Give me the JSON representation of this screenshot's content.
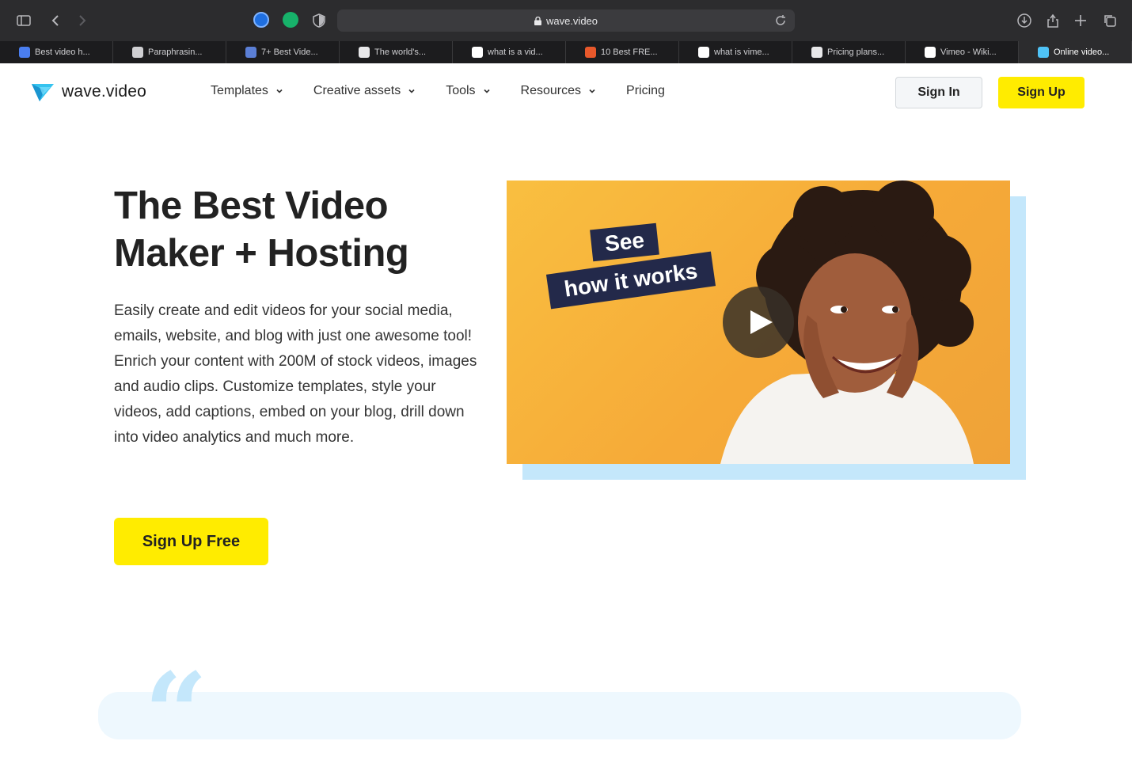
{
  "browser": {
    "url": "wave.video",
    "tabs": [
      {
        "label": "Best video h...",
        "color": "#4a7ef0"
      },
      {
        "label": "Paraphrasin...",
        "color": "#cfcfd2"
      },
      {
        "label": "7+ Best Vide...",
        "color": "#5b7fd6"
      },
      {
        "label": "The world's...",
        "color": "#e8e8ea"
      },
      {
        "label": "what is a vid...",
        "color": "#ffffff"
      },
      {
        "label": "10 Best FRE...",
        "color": "#e8582b"
      },
      {
        "label": "what is vime...",
        "color": "#ffffff"
      },
      {
        "label": "Pricing plans...",
        "color": "#e8e8ea"
      },
      {
        "label": "Vimeo - Wiki...",
        "color": "#ffffff"
      },
      {
        "label": "Online video...",
        "color": "#4fc3f7"
      }
    ]
  },
  "site": {
    "logo_text": "wave.video",
    "nav": [
      {
        "label": "Templates",
        "dropdown": true
      },
      {
        "label": "Creative assets",
        "dropdown": true
      },
      {
        "label": "Tools",
        "dropdown": true
      },
      {
        "label": "Resources",
        "dropdown": true
      },
      {
        "label": "Pricing",
        "dropdown": false
      }
    ],
    "sign_in": "Sign In",
    "sign_up": "Sign Up"
  },
  "hero": {
    "title_line1": "The Best Video",
    "title_line2": "Maker + Hosting",
    "desc_p1": "Easily create and edit videos for your social media, emails, website, and blog with just one awesome tool!",
    "desc_p2": "Enrich your content with 200M of stock videos, images and audio clips. Customize templates, style your videos, add captions, embed on your blog, drill down into video analytics and much more.",
    "cta": "Sign Up Free",
    "video_tag_1": "See",
    "video_tag_2": "how it works"
  },
  "colors": {
    "accent_yellow": "#ffec00",
    "video_bg": "#f6aa38",
    "shadow_blue": "#c4e7fb",
    "tag_navy": "#23294a"
  }
}
